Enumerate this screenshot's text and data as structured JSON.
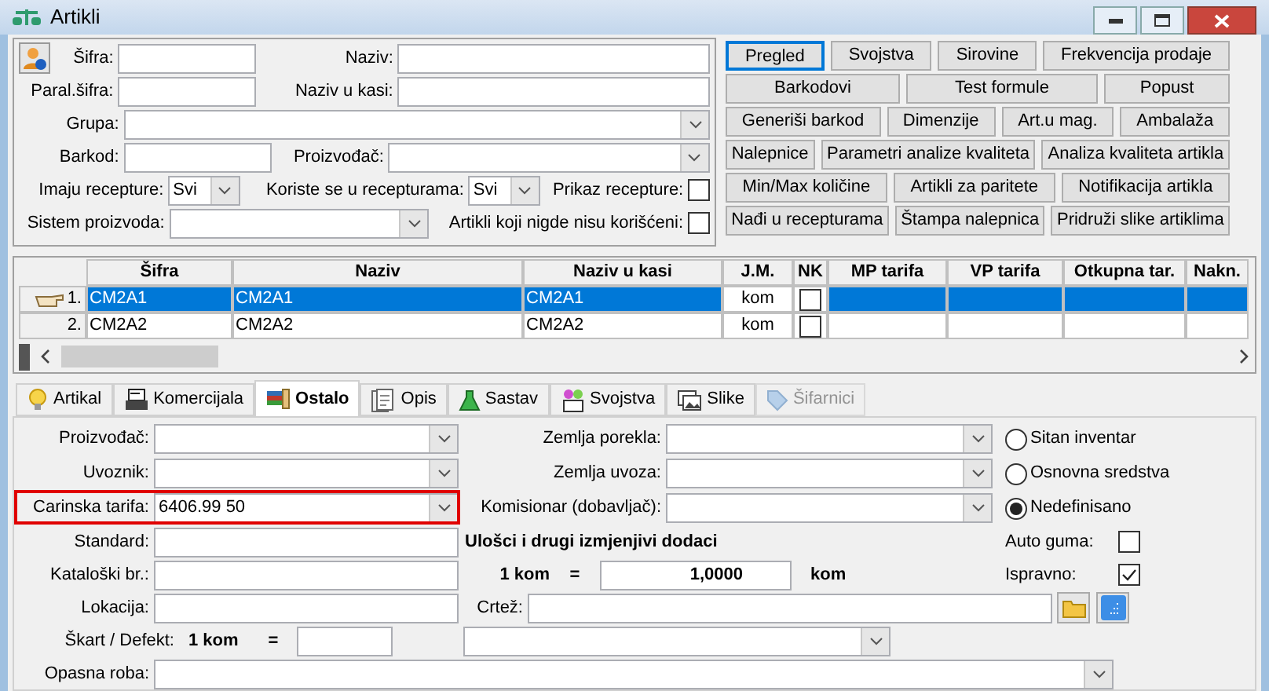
{
  "window": {
    "title": "Artikli"
  },
  "filters": {
    "rows": [
      {
        "kind": "pair",
        "left": {
          "label": "Šifra:"
        },
        "right": {
          "label": "Naziv:"
        }
      },
      {
        "kind": "pair",
        "left": {
          "label": "Paral.šifra:"
        },
        "right": {
          "label": "Naziv u kasi:"
        }
      },
      {
        "kind": "combo",
        "label": "Grupa:"
      },
      {
        "kind": "pair_combo",
        "left": {
          "label": "Barkod:"
        },
        "right": {
          "label": "Proizvođač:"
        }
      },
      {
        "kind": "recipes",
        "left": {
          "label": "Imaju recepture:",
          "value": "Svi"
        },
        "middle": {
          "label": "Koriste se u recepturama:",
          "value": "Svi"
        },
        "check": {
          "label": "Prikaz recepture:",
          "checked": false
        }
      },
      {
        "kind": "system",
        "left": {
          "label": "Sistem proizvoda:"
        },
        "check": {
          "label": "Artikli koji nigde nisu korišćeni:",
          "checked": false
        }
      }
    ]
  },
  "buttons": [
    [
      {
        "label": "Pregled",
        "selected": true
      },
      {
        "label": "Svojstva",
        "selected": false
      },
      {
        "label": "Sirovine",
        "selected": false
      },
      {
        "label": "Frekvencija prodaje",
        "selected": false
      }
    ],
    [
      {
        "label": "Barkodovi",
        "selected": false
      },
      {
        "label": "Test formule",
        "selected": false
      },
      {
        "label": "Popust",
        "selected": false
      }
    ],
    [
      {
        "label": "Generiši barkod",
        "selected": false
      },
      {
        "label": "Dimenzije",
        "selected": false
      },
      {
        "label": "Art.u mag.",
        "selected": false
      },
      {
        "label": "Ambalaža",
        "selected": false
      }
    ],
    [
      {
        "label": "Nalepnice",
        "selected": false
      },
      {
        "label": "Parametri analize kvaliteta",
        "selected": false
      },
      {
        "label": "Analiza kvaliteta artikla",
        "selected": false
      }
    ],
    [
      {
        "label": "Min/Max količine",
        "selected": false
      },
      {
        "label": "Artikli za paritete",
        "selected": false
      },
      {
        "label": "Notifikacija artikla",
        "selected": false
      }
    ],
    [
      {
        "label": "Nađi u recepturama",
        "selected": false
      },
      {
        "label": "Štampa nalepnica",
        "selected": false
      },
      {
        "label": "Pridruži slike artiklima",
        "selected": false
      }
    ]
  ],
  "table": {
    "columns": [
      "Šifra",
      "Naziv",
      "Naziv u kasi",
      "J.M.",
      "NK",
      "MP tarifa",
      "VP tarifa",
      "Otkupna tar.",
      "Nakn."
    ],
    "rows": [
      {
        "number": "1.",
        "sifra": "CM2A1",
        "naziv": "CM2A1",
        "naziv_u_kasi": "CM2A1",
        "jm": "kom",
        "nk": false,
        "selected": true
      },
      {
        "number": "2.",
        "sifra": "CM2A2",
        "naziv": "CM2A2",
        "naziv_u_kasi": "CM2A2",
        "jm": "kom",
        "nk": false,
        "selected": false
      }
    ]
  },
  "tabs": [
    {
      "label": "Artikal",
      "selected": false,
      "disabled": false
    },
    {
      "label": "Komercijala",
      "selected": false,
      "disabled": false
    },
    {
      "label": "Ostalo",
      "selected": true,
      "disabled": false
    },
    {
      "label": "Opis",
      "selected": false,
      "disabled": false
    },
    {
      "label": "Sastav",
      "selected": false,
      "disabled": false
    },
    {
      "label": "Svojstva",
      "selected": false,
      "disabled": false
    },
    {
      "label": "Slike",
      "selected": false,
      "disabled": false
    },
    {
      "label": "Šifarnici",
      "selected": false,
      "disabled": true
    }
  ],
  "form": {
    "left_fields": [
      {
        "label": "Proizvođač:",
        "kind": "combo",
        "highlighted": false
      },
      {
        "label": "Uvoznik:",
        "kind": "combo",
        "highlighted": false
      },
      {
        "label": "Carinska tarifa:",
        "kind": "combo",
        "value": "6406.99 50",
        "highlighted": true
      },
      {
        "label": "Standard:",
        "kind": "text",
        "highlighted": false
      },
      {
        "label": "Kataloški br.:",
        "kind": "text",
        "highlighted": false
      },
      {
        "label": "Lokacija:",
        "kind": "text",
        "highlighted": false
      }
    ],
    "middle_fields": [
      {
        "label": "Zemlja porekla:"
      },
      {
        "label": "Zemlja uvoza:"
      },
      {
        "label": "Komisionar (dobavljač):"
      }
    ],
    "inserts_title": "Ulošci i drugi izmjenjivi dodaci",
    "conversion": {
      "quantity": "1 kom",
      "equals": "=",
      "value": "1,0000",
      "unit": "kom"
    },
    "drawing": {
      "label": "Crtež:"
    },
    "defect": {
      "label": "Škart / Defekt:",
      "quantity": "1 kom",
      "equals": "="
    },
    "dangerous": {
      "label": "Opasna roba:"
    },
    "inventory_type": [
      {
        "label": "Sitan inventar",
        "selected": false
      },
      {
        "label": "Osnovna sredstva",
        "selected": false
      },
      {
        "label": "Nedefinisano",
        "selected": true
      }
    ],
    "checks": [
      {
        "label": "Auto guma:",
        "checked": false
      },
      {
        "label": "Ispravno:",
        "checked": true
      }
    ]
  }
}
